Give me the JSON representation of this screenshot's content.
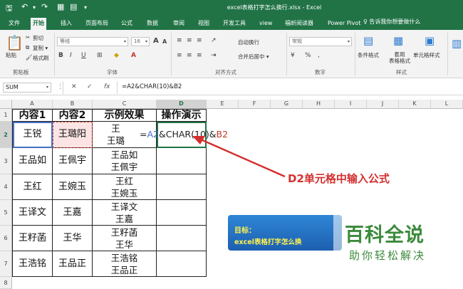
{
  "titlebar": {
    "title": "excel表格打字怎么换行.xlsx - Excel",
    "qa_icons": [
      "save-icon",
      "undo-icon",
      "redo-icon",
      "table-icon",
      "page-icon",
      "quickaccess-more-icon"
    ]
  },
  "tabs": [
    {
      "label": "文件",
      "active": false
    },
    {
      "label": "开始",
      "active": true
    },
    {
      "label": "插入",
      "active": false
    },
    {
      "label": "页面布局",
      "active": false
    },
    {
      "label": "公式",
      "active": false
    },
    {
      "label": "数据",
      "active": false
    },
    {
      "label": "审阅",
      "active": false
    },
    {
      "label": "视图",
      "active": false
    },
    {
      "label": "开发工具",
      "active": false
    },
    {
      "label": "view",
      "active": false
    },
    {
      "label": "福昕阅读器",
      "active": false
    },
    {
      "label": "Power Pivot",
      "active": false
    }
  ],
  "tellme": "♀ 告诉我你想要做什么",
  "ribbon": {
    "clipboard": {
      "paste": "粘贴",
      "cut": "剪切",
      "copy": "复制 ▾",
      "format_painter": "格式刷",
      "label": "剪贴板"
    },
    "font": {
      "name": "等线",
      "size": "16",
      "grow": "A",
      "shrink": "A",
      "bold": "B",
      "italic": "I",
      "underline": "U",
      "label": "字体"
    },
    "align": {
      "wrap": "自动换行",
      "merge": "合并后居中 ▾",
      "label": "对齐方式"
    },
    "number": {
      "format": "常规",
      "label": "数字"
    },
    "styles": {
      "cond": "条件格式",
      "table": "套用\n表格格式",
      "cell": "单元格样式",
      "label": "样式"
    }
  },
  "formula_bar": {
    "name_box": "SUM",
    "cancel": "✕",
    "confirm": "✓",
    "fx": "fx",
    "formula": "=A2&CHAR(10)&B2"
  },
  "grid": {
    "columns": [
      "A",
      "B",
      "C",
      "D",
      "E",
      "F",
      "G",
      "H",
      "I",
      "J",
      "K",
      "L"
    ],
    "rows": [
      "1",
      "2",
      "3",
      "4",
      "5",
      "6",
      "7",
      "8"
    ],
    "headers": [
      "内容1",
      "内容2",
      "示例效果",
      "操作演示"
    ],
    "data": [
      {
        "a": "王锐",
        "b": "王璐阳",
        "c1": "王",
        "c2": "王璐"
      },
      {
        "a": "王品如",
        "b": "王佩宇",
        "c1": "王品如",
        "c2": "王佩宇"
      },
      {
        "a": "王红",
        "b": "王婉玉",
        "c1": "王红",
        "c2": "王婉玉"
      },
      {
        "a": "王译文",
        "b": "王嘉",
        "c1": "王译文",
        "c2": "王嘉"
      },
      {
        "a": "王籽菡",
        "b": "王华",
        "c1": "王籽菡",
        "c2": "王华"
      },
      {
        "a": "王浩铭",
        "b": "王品正",
        "c1": "王浩铭",
        "c2": "王品正"
      }
    ],
    "edit": {
      "p1": "=",
      "p2": "A2",
      "p3": "&CHAR(10)&",
      "p4": "B2"
    }
  },
  "annotation": "D2单元格中输入公式",
  "banner": {
    "line1": "目标：",
    "line2": "excel表格打字怎么换"
  },
  "watermark": {
    "big": "百科全说",
    "small": "助你轻松解决"
  },
  "colors": {
    "excel_green": "#217346",
    "annotation_red": "#d32f2f",
    "ref_blue": "#4472c4",
    "ref_red": "#c0392b",
    "watermark_green": "#3b8a3b"
  }
}
